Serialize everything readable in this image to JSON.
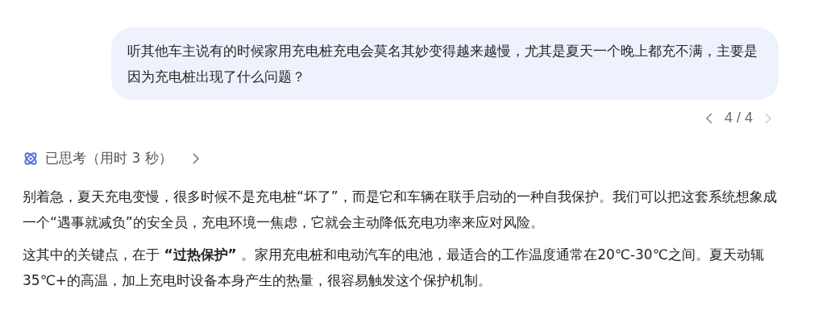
{
  "user_message": {
    "text": "听其他车主说有的时候家用充电桩充电会莫名其妙变得越来越慢，尤其是夏天一个晚上都充不满，主要是因为充电桩出现了什么问题？"
  },
  "pager": {
    "label": "4 / 4",
    "prev_disabled": false,
    "next_disabled": true
  },
  "thinking": {
    "label": "已思考（用时 3 秒）",
    "expanded": false
  },
  "answer_paragraphs": [
    "别着急，夏天充电变慢，很多时候不是充电桩“坏了”，而是它和车辆在联手启动的一种自我保护。我们可以把这套系统想象成一个“遇事就减负”的安全员，充电环境一焦虑，它就会主动降低充电功率来应对风险。",
    "这其中的关键点，在于 **“过热保护”** 。家用充电桩和电动汽车的电池，最适合的工作温度通常在20℃-30℃之间。夏天动辄35℃+的高温，加上充电时设备本身产生的热量，很容易触发这个保护机制。"
  ]
}
